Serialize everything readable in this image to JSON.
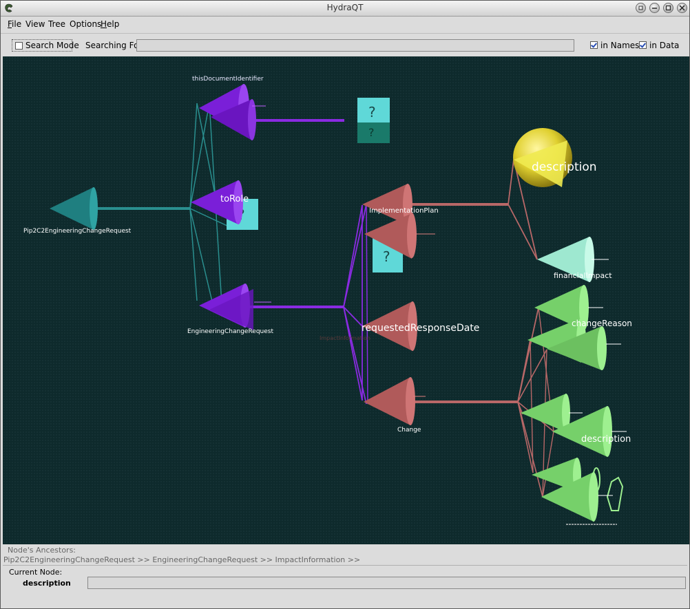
{
  "window": {
    "title": "HydraQT"
  },
  "menu": {
    "file": "F",
    "file_rest": "ile",
    "view": "View",
    "tree": "Tree",
    "options": "Options",
    "help": "H",
    "help_rest": "elp"
  },
  "toolbar": {
    "search_mode_label": "Search Mode",
    "search_mode_checked": false,
    "searching_for_label": "Searching For:",
    "search_value": "",
    "in_names_label": "in Names",
    "in_names_checked": true,
    "in_data_label": "in Data",
    "in_data_checked": true
  },
  "graph": {
    "background": "#0e2a2c",
    "colors": {
      "teal": "#2a8f8f",
      "purple": "#8a2be2",
      "rose": "#c06868",
      "green": "#86e07a",
      "yellow": "#e0d030",
      "mint": "#aef0d8",
      "cyan": "#5fd8d8"
    },
    "labels": {
      "root": "Pip2C2EngineeringChangeRequest",
      "this_doc": "thisDocumentIdentifier",
      "to_role": "toRole",
      "ecr": "EngineeringChangeRequest",
      "impl_plan": "ImplementationPlan",
      "req_resp_date": "requestedResponseDate",
      "change": "Change",
      "description_top": "description",
      "financial_impact": "financialImpact",
      "change_reason": "changeReason",
      "description_bottom": "description",
      "faint_left": "ImpactInformation"
    }
  },
  "ancestors": {
    "label": "Node's Ancestors:",
    "path": "Pip2C2EngineeringChangeRequest >> EngineeringChangeRequest >> ImpactInformation >>"
  },
  "current_node": {
    "label": "Current Node:",
    "name": "description",
    "value": ""
  }
}
